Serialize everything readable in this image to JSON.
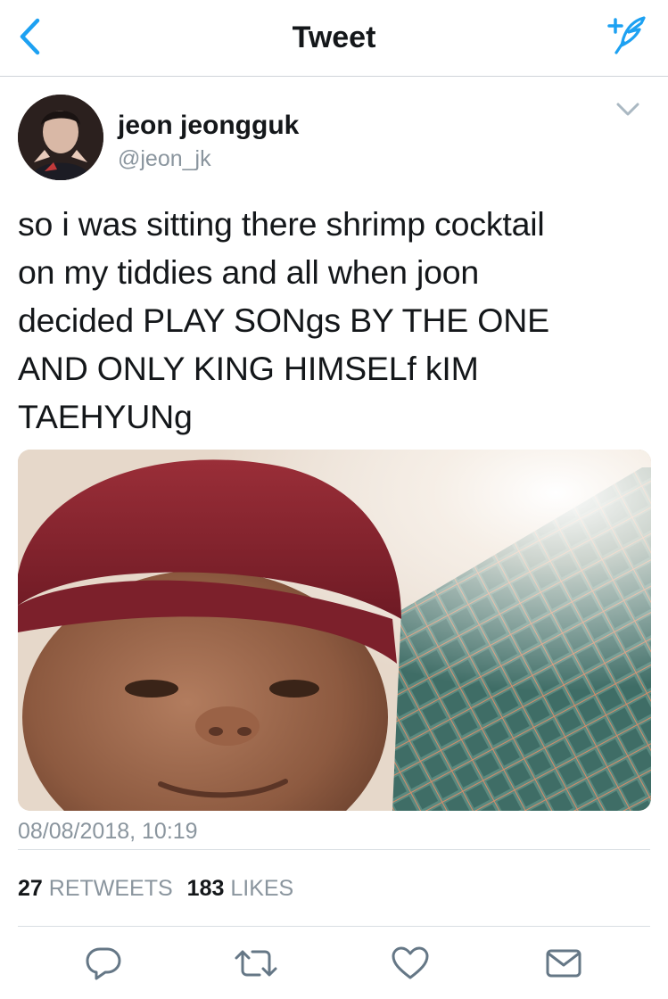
{
  "nav": {
    "title": "Tweet",
    "back_icon": "chevron-left-icon",
    "compose_icon": "compose-feather-icon",
    "accent_color": "#1da1f2"
  },
  "tweet": {
    "author": {
      "name": "jeon jeongguk",
      "handle": "@jeon_jk"
    },
    "text_lines": [
      "so i was sitting there shrimp cocktail",
      "on my tiddies and all when joon",
      "decided PLAY SONgs BY THE ONE",
      "AND ONLY KING HIMSELf kIM",
      "TAEHYUNg"
    ],
    "timestamp": "08/08/2018, 10:19",
    "retweets": {
      "count": "27",
      "label": "RETWEETS"
    },
    "likes": {
      "count": "183",
      "label": "LIKES"
    },
    "media_description_icon": "photo-icon"
  },
  "actions": [
    {
      "icon": "reply-icon"
    },
    {
      "icon": "retweet-icon"
    },
    {
      "icon": "like-heart-icon"
    },
    {
      "icon": "direct-message-icon"
    }
  ],
  "colors": {
    "text": "#14171a",
    "secondary_text": "#8a959e",
    "divider": "#d9dee3",
    "icon_gray": "#657786"
  }
}
